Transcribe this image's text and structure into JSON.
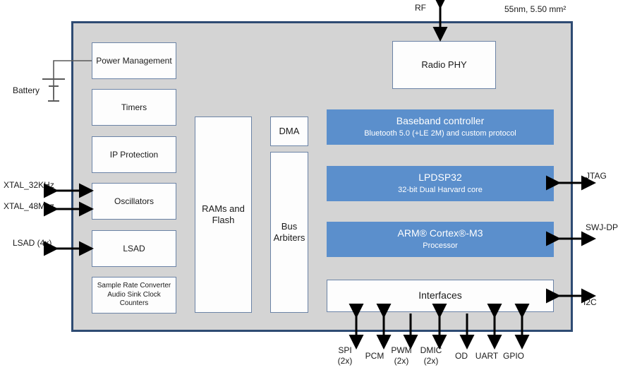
{
  "diagram": {
    "die_note": "55nm, 5.50 mm²",
    "die_fill": "#d4d4d4",
    "die_border": "#2e4b73",
    "accent_blue": "#5b8fcc",
    "block_border": "#6b83a6"
  },
  "power_column": [
    {
      "label": "Power Management"
    },
    {
      "label": "Timers"
    },
    {
      "label": "IP Protection"
    },
    {
      "label": "Oscillators"
    },
    {
      "label": "LSAD"
    },
    {
      "label": "Sample Rate Converter",
      "label2": "Audio Sink Clock Counters"
    }
  ],
  "memory": {
    "ram_line1": "RAMs and",
    "ram_line2": "Flash"
  },
  "bus": {
    "dma": "DMA",
    "arbiters_line1": "Bus",
    "arbiters_line2": "Arbiters"
  },
  "radio": {
    "phy": "Radio PHY",
    "rf_label": "RF"
  },
  "cores": [
    {
      "title": "Baseband controller",
      "subtitle": "Bluetooth 5.0 (+LE 2M) and custom protocol"
    },
    {
      "title": "LPDSP32",
      "subtitle": "32-bit Dual Harvard core"
    },
    {
      "title": "ARM® Cortex®-M3",
      "subtitle": "Processor"
    }
  ],
  "interfaces": {
    "title": "Interfaces"
  },
  "left_pins": [
    {
      "label": "Battery"
    },
    {
      "label": "XTAL_32KHz"
    },
    {
      "label": "XTAL_48Mhz"
    },
    {
      "label": "LSAD (4x)"
    }
  ],
  "right_pins": [
    {
      "label": "JTAG"
    },
    {
      "label": "SWJ-DP"
    },
    {
      "label": "I2C"
    }
  ],
  "bottom_pins": [
    {
      "label": "SPI",
      "label2": "(2x)"
    },
    {
      "label": "PCM",
      "label2": ""
    },
    {
      "label": "PWM",
      "label2": "(2x)"
    },
    {
      "label": "DMIC",
      "label2": "(2x)"
    },
    {
      "label": "OD",
      "label2": ""
    },
    {
      "label": "UART",
      "label2": ""
    },
    {
      "label": "GPIO",
      "label2": ""
    }
  ]
}
